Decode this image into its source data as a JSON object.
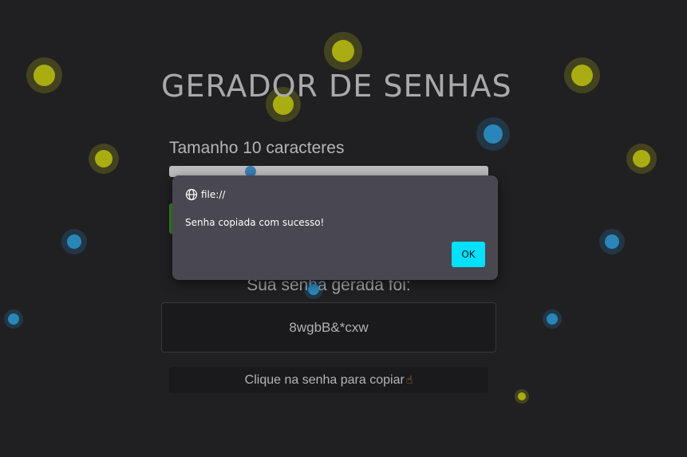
{
  "page": {
    "title": "GERADOR DE SENHAS",
    "length_label": "Tamanho 10 caracteres",
    "result_label": "Sua senha gerada foi:",
    "password": "8wgbB&*cxw",
    "copy_hint": "Clique na senha para copiar",
    "copy_hint_icon": "pointing-hand-icon"
  },
  "dialog": {
    "origin": "file://",
    "origin_icon": "globe-icon",
    "message": "Senha copiada com sucesso!",
    "ok_label": "OK"
  },
  "colors": {
    "background": "#202023",
    "yellow_dot": "#a9ad12",
    "blue_dot": "#2a86b8",
    "dialog_bg": "#49474f",
    "ok_button": "#00e0ff",
    "generate_button": "#3c8a2c"
  }
}
